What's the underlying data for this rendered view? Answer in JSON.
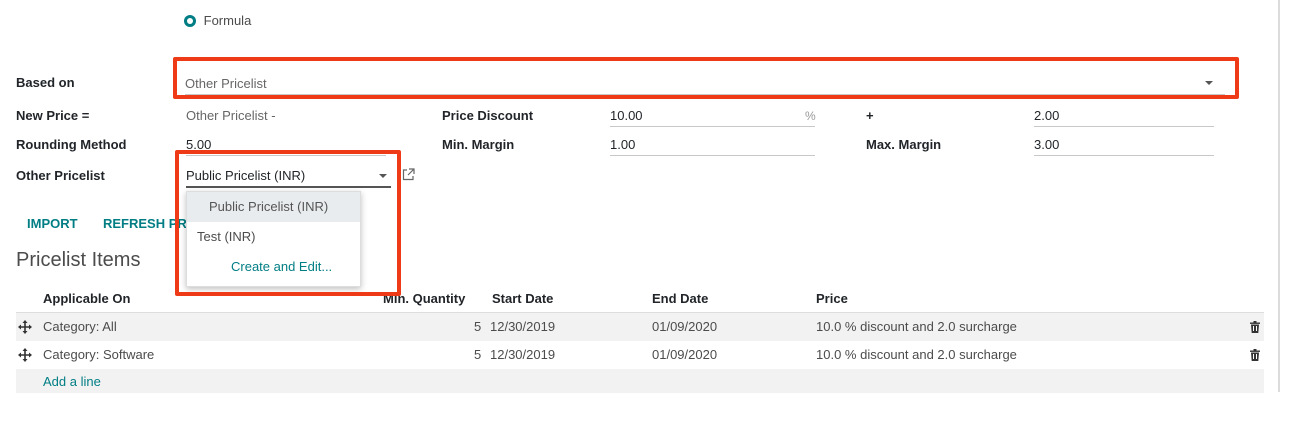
{
  "formula": {
    "label": "Formula"
  },
  "form": {
    "based_on": {
      "label": "Based on",
      "value": "Other Pricelist"
    },
    "new_price": {
      "label": "New Price =",
      "value": "Other Pricelist -"
    },
    "price_discount": {
      "label": "Price Discount",
      "value": "10.00",
      "unit": "%"
    },
    "surcharge": {
      "label": "+",
      "value": "2.00"
    },
    "rounding_method": {
      "label": "Rounding Method",
      "value": "5.00"
    },
    "min_margin": {
      "label": "Min. Margin",
      "value": "1.00"
    },
    "max_margin": {
      "label": "Max. Margin",
      "value": "3.00"
    },
    "other_pricelist": {
      "label": "Other Pricelist",
      "value": "Public Pricelist (INR)"
    }
  },
  "dropdown": {
    "options": [
      "Public Pricelist (INR)",
      "Test (INR)"
    ],
    "create": "Create and Edit..."
  },
  "buttons": {
    "import": "IMPORT",
    "refresh": "REFRESH PR"
  },
  "section_title": "Pricelist Items",
  "table": {
    "headers": {
      "applicable_on": "Applicable On",
      "min_quantity": "Min. Quantity",
      "start_date": "Start Date",
      "end_date": "End Date",
      "price": "Price"
    },
    "rows": [
      {
        "applicable_on": "Category: All",
        "min_quantity": "5",
        "start_date": "12/30/2019",
        "end_date": "01/09/2020",
        "price": "10.0 % discount and 2.0 surcharge"
      },
      {
        "applicable_on": "Category: Software",
        "min_quantity": "5",
        "start_date": "12/30/2019",
        "end_date": "01/09/2020",
        "price": "10.0 % discount and 2.0 surcharge"
      }
    ],
    "add_line": "Add a line"
  },
  "colors": {
    "accent": "#017e84",
    "highlight": "#ee3a17"
  },
  "icons": {
    "drag": "move-icon",
    "delete": "trash-icon",
    "external": "external-link-icon",
    "dropdown": "caret-down-icon"
  }
}
